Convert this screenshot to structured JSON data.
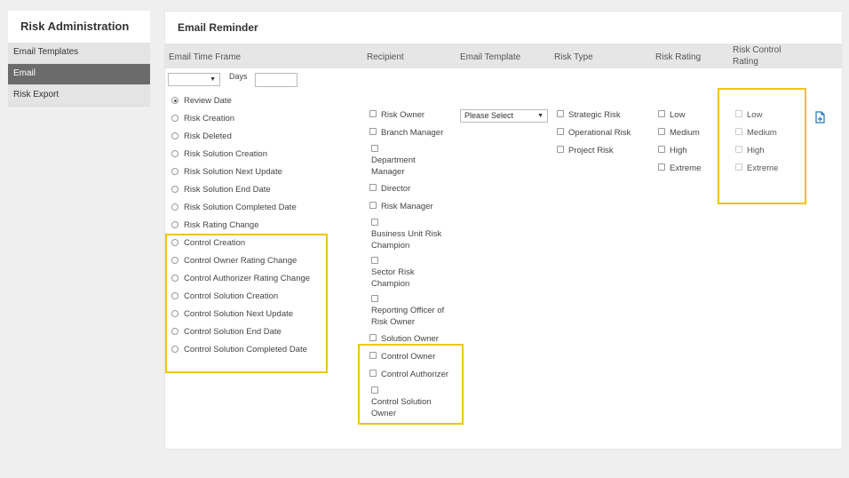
{
  "sidebar": {
    "title": "Risk Administration",
    "items": [
      {
        "label": "Email Templates",
        "active": false
      },
      {
        "label": "Email",
        "active": true
      },
      {
        "label": "Risk Export",
        "active": false
      }
    ]
  },
  "main": {
    "title": "Email Reminder",
    "headers": {
      "time_frame": "Email Time Frame",
      "recipient": "Recipient",
      "template": "Email Template",
      "risk_type": "Risk Type",
      "risk_rating": "Risk Rating",
      "control_rating_line1": "Risk Control",
      "control_rating_line2": "Rating"
    },
    "time_frame_select": "",
    "days_label": "Days",
    "days_value": "",
    "time_frame_options": [
      "Review Date",
      "Risk Creation",
      "Risk Deleted",
      "Risk Solution Creation",
      "Risk Solution Next Update",
      "Risk Solution End Date",
      "Risk Solution Completed Date",
      "Risk Rating Change",
      "Control Creation",
      "Control Owner Rating Change",
      "Control Authorizer Rating Change",
      "Control Solution Creation",
      "Control Solution Next Update",
      "Control Solution End Date",
      "Control Solution Completed Date"
    ],
    "selected_time_frame": "Review Date",
    "recipients": {
      "risk_owner": "Risk Owner",
      "branch_manager": "Branch Manager",
      "department_manager_1": "Department",
      "department_manager_2": "Manager",
      "director": "Director",
      "risk_manager": "Risk Manager",
      "bu_champion_1": "Business Unit Risk",
      "bu_champion_2": "Champion",
      "sector_champion_1": "Sector Risk",
      "sector_champion_2": "Champion",
      "reporting_officer_1": "Reporting Officer of",
      "reporting_officer_2": "Risk Owner",
      "solution_owner": "Solution Owner",
      "control_owner": "Control Owner",
      "control_authorizer": "Control Authorizer",
      "control_solution_owner_1": "Control Solution",
      "control_solution_owner_2": "Owner"
    },
    "template_select": "Please Select",
    "risk_types": [
      "Strategic Risk",
      "Operational Risk",
      "Project Risk"
    ],
    "risk_ratings": [
      "Low",
      "Medium",
      "High",
      "Extreme"
    ],
    "control_ratings": [
      "Low",
      "Medium",
      "High",
      "Extreme"
    ],
    "highlight_color": "#f1c40f",
    "active_nav_color": "#6b6b6b",
    "icon": "add-file-icon"
  }
}
